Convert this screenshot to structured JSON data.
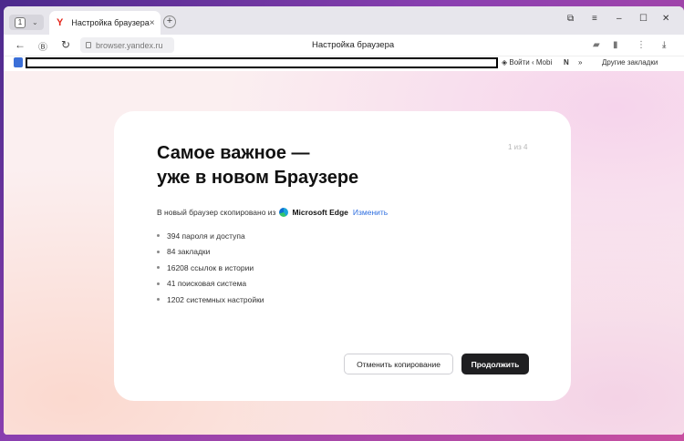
{
  "browser": {
    "tab_count": "1",
    "tab_title": "Настройка браузера",
    "new_tab": "+",
    "url": "browser.yandex.ru",
    "page_title": "Настройка браузера"
  },
  "bookmarks": {
    "items": [
      "Войти ‹ Mobi",
      "Другие закладки"
    ],
    "more": "»"
  },
  "card": {
    "heading_line1": "Самое важное —",
    "heading_line2": "уже в новом Браузере",
    "step": "1 из 4",
    "copied_prefix": "В новый браузер скопировано из",
    "source_browser": "Microsoft Edge",
    "change_link": "Изменить",
    "items": [
      "394 пароля и доступа",
      "84 закладки",
      "16208 ссылок в истории",
      "41 поисковая система",
      "1202 системных настройки"
    ],
    "cancel_button": "Отменить копирование",
    "continue_button": "Продолжить"
  },
  "colors": {
    "accent_link": "#2f6fe0",
    "primary_button": "#1f1f21",
    "yandex_red": "#e4261b"
  }
}
